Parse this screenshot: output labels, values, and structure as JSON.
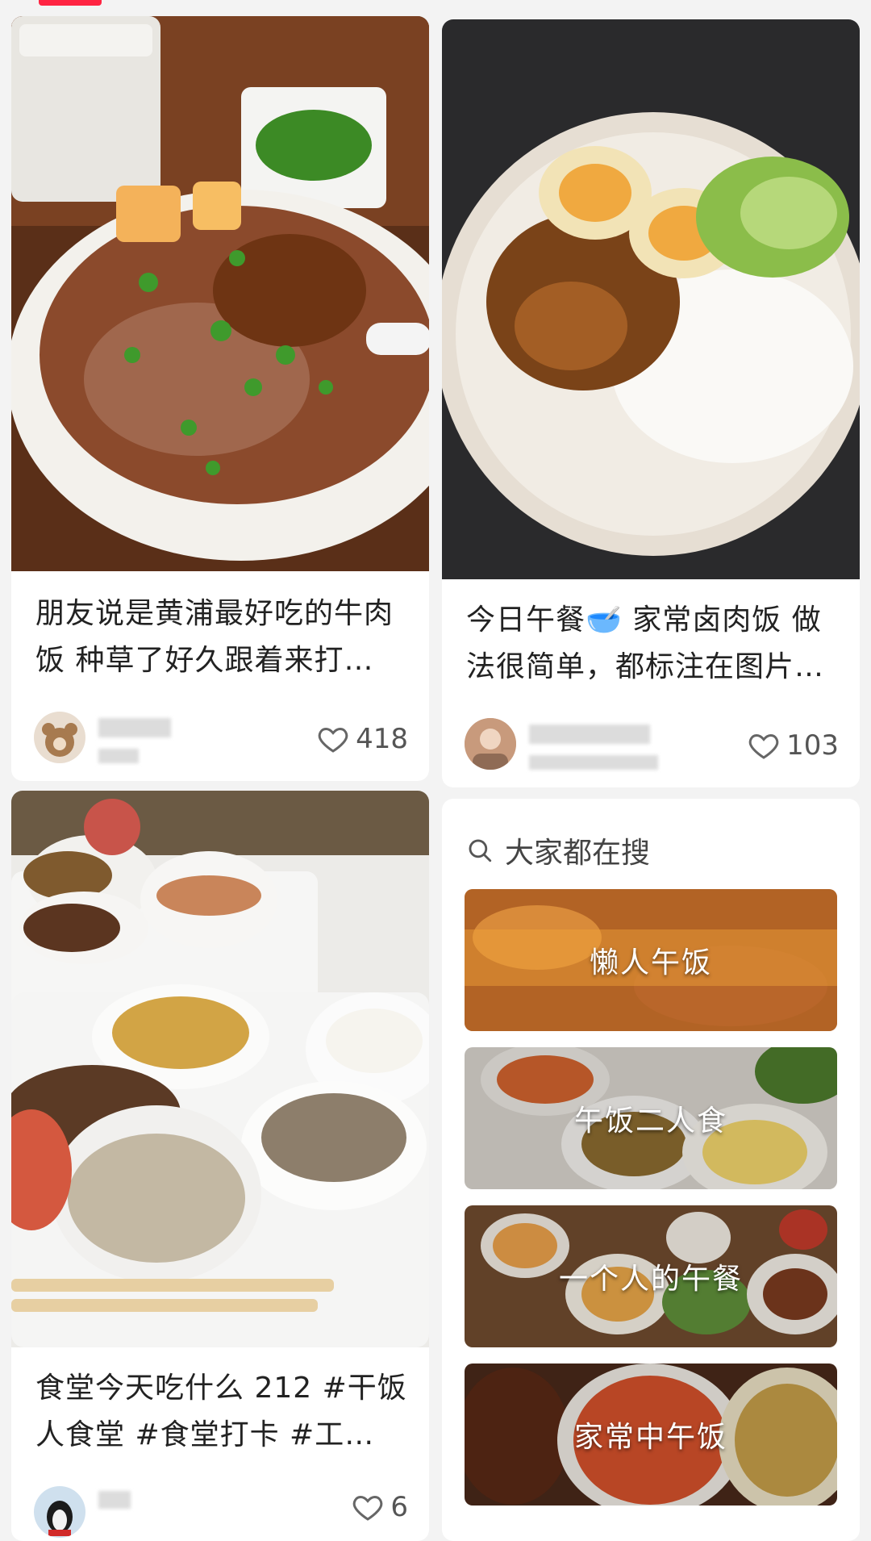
{
  "tab_indicator_color": "#ff2442",
  "posts": [
    {
      "title": "朋友说是黄浦最好吃的牛肉饭 种草了好久跟着来打…",
      "likes": "418",
      "avatar": "bear-avatar"
    },
    {
      "title": "今日午餐🥣 家常卤肉饭 做法很简单，都标注在图片…",
      "likes": "103",
      "avatar": "person-avatar"
    },
    {
      "title": "食堂今天吃什么 212 #干饭人食堂 #食堂打卡 #工…",
      "likes": "6",
      "avatar": "penguin-avatar"
    }
  ],
  "search_panel": {
    "heading": "大家都在搜",
    "icon": "search-icon",
    "items": [
      "懒人午饭",
      "午饭二人食",
      "一个人的午餐",
      "家常中午饭"
    ]
  }
}
